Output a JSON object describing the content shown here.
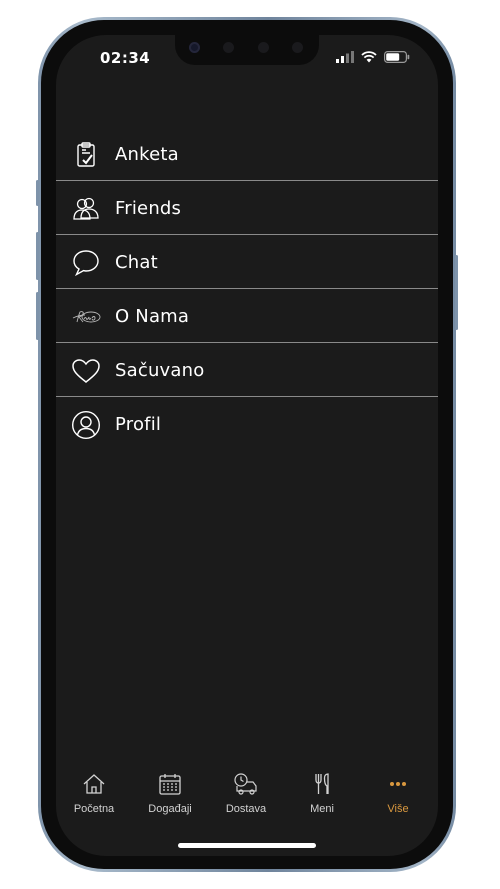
{
  "status_bar": {
    "time": "02:34"
  },
  "menu": {
    "items": [
      {
        "label": "Anketa",
        "icon": "clipboard-check-icon"
      },
      {
        "label": "Friends",
        "icon": "friends-icon"
      },
      {
        "label": "Chat",
        "icon": "chat-bubble-icon"
      },
      {
        "label": "O Nama",
        "icon": "signature-logo-icon"
      },
      {
        "label": "Sačuvano",
        "icon": "heart-icon"
      },
      {
        "label": "Profil",
        "icon": "user-circle-icon"
      }
    ]
  },
  "tab_bar": {
    "tabs": [
      {
        "label": "Početna",
        "icon": "home-icon"
      },
      {
        "label": "Događaji",
        "icon": "calendar-icon"
      },
      {
        "label": "Dostava",
        "icon": "delivery-truck-icon"
      },
      {
        "label": "Meni",
        "icon": "fork-knife-icon"
      },
      {
        "label": "Više",
        "icon": "more-dots-icon"
      }
    ],
    "active": "Više"
  },
  "colors": {
    "background": "#1b1b1b",
    "text": "#ffffff",
    "divider": "#8a8a8a",
    "accent": "#d9983f",
    "frame": "#8fa3b8"
  }
}
